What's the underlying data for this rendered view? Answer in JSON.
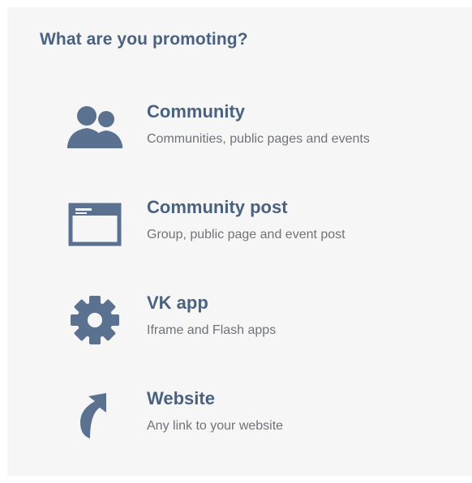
{
  "heading": "What are you promoting?",
  "accent_color": "#4a6280",
  "options": [
    {
      "icon": "users-icon",
      "label": "Community",
      "description": "Communities, public pages and events"
    },
    {
      "icon": "post-window-icon",
      "label": "Community post",
      "description": "Group, public page and event post"
    },
    {
      "icon": "gear-icon",
      "label": "VK app",
      "description": "Iframe and Flash apps"
    },
    {
      "icon": "external-link-arrow-icon",
      "label": "Website",
      "description": "Any link to your website"
    }
  ]
}
